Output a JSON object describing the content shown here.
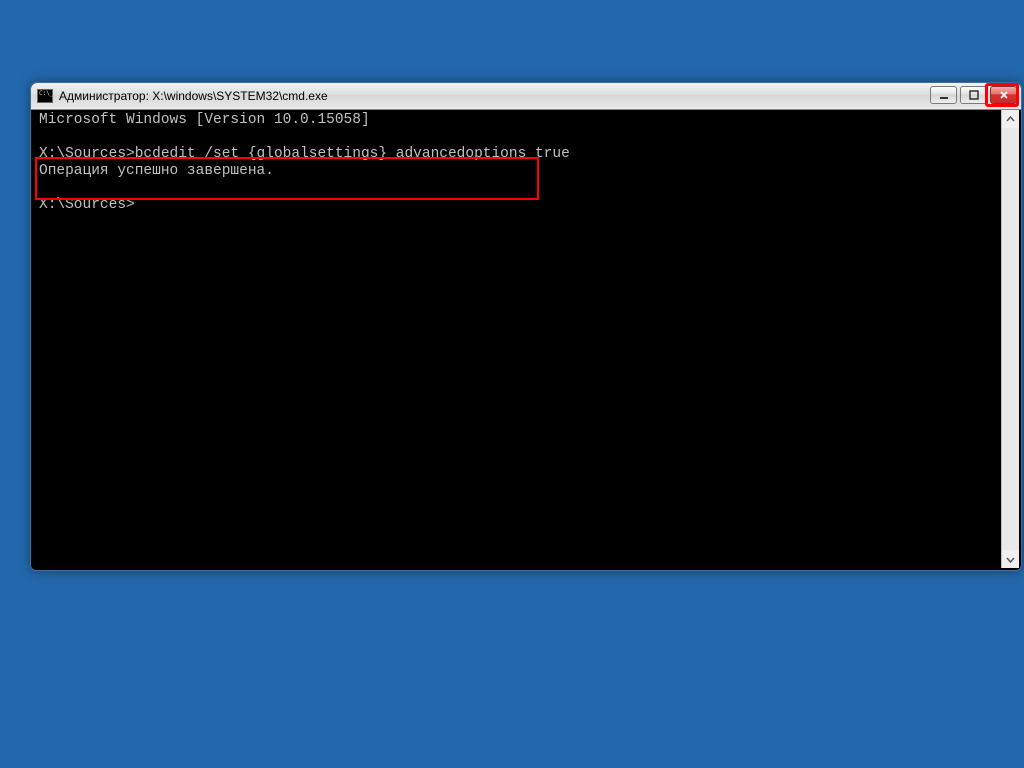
{
  "window": {
    "title": "Администратор: X:\\windows\\SYSTEM32\\cmd.exe"
  },
  "terminal": {
    "line1": "Microsoft Windows [Version 10.0.15058]",
    "blank1": "",
    "prompt1": "X:\\Sources>",
    "command1": "bcdedit /set {globalsettings} advancedoptions true",
    "result1": "Операция успешно завершена.",
    "blank2": "",
    "prompt2": "X:\\Sources>"
  }
}
